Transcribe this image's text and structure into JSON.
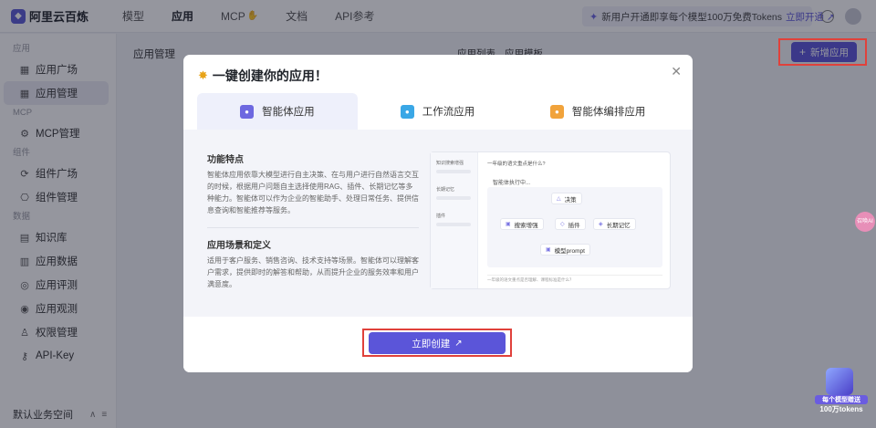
{
  "brand": {
    "name": "阿里云百炼"
  },
  "topnav": [
    {
      "label": "模型"
    },
    {
      "label": "应用"
    },
    {
      "label": "MCP"
    },
    {
      "label": "文档"
    },
    {
      "label": "API参考"
    }
  ],
  "promo": {
    "text": "新用户开通即享每个模型100万免费Tokens",
    "link": "立即开通 ↗"
  },
  "sidebar": {
    "groups": {
      "app": "应用",
      "mcp": "MCP",
      "component": "组件",
      "data": "数据"
    },
    "items": {
      "app_square": "应用广场",
      "app_manage": "应用管理",
      "mcp_manage": "MCP管理",
      "component_square": "组件广场",
      "component_manage": "组件管理",
      "knowledge": "知识库",
      "app_data": "应用数据",
      "app_eval": "应用评测",
      "app_observe": "应用观测",
      "permission": "权限管理",
      "apikey": "API-Key"
    },
    "workspace": "默认业务空间"
  },
  "main": {
    "title": "应用管理",
    "tab_list": "应用列表",
    "tab_template": "应用模板",
    "new_app": "新增应用"
  },
  "modal": {
    "title": "一键创建你的应用！",
    "tabs": [
      "智能体应用",
      "工作流应用",
      "智能体编排应用"
    ],
    "features_title": "功能特点",
    "features_text": "智能体应用依靠大模型进行自主决策、在与用户进行自然语言交互的时候，根据用户问题自主选择使用RAG、插件、长期记忆等多种能力。智能体可以作为企业的智能助手、处理日常任务、提供信息查询和智能推荐等服务。",
    "scenes_title": "应用场景和定义",
    "scenes_text": "适用于客户服务、销售咨询、技术支持等场景。智能体可以理解客户需求，提供即时的解答和帮助，从而提升企业的服务效率和用户满意度。",
    "preview": {
      "left_label_1": "知识搜索增强",
      "left_label_2": "长期记忆",
      "left_label_3": "插件",
      "question": "一年级的语文重点是什么?",
      "status": "智能体执行中...",
      "node_decide": "决策",
      "node_search": "搜索增强",
      "node_plugin": "插件",
      "node_memory": "长期记忆",
      "node_model": "模型prompt",
      "input_placeholder": "一年级的语文重点是否理解、课程标准是什么？"
    },
    "create_btn": "立即创建"
  },
  "floaters": {
    "chip": "召唤AI",
    "badge_line1": "每个模型赠送",
    "badge_line2": "100万tokens"
  }
}
